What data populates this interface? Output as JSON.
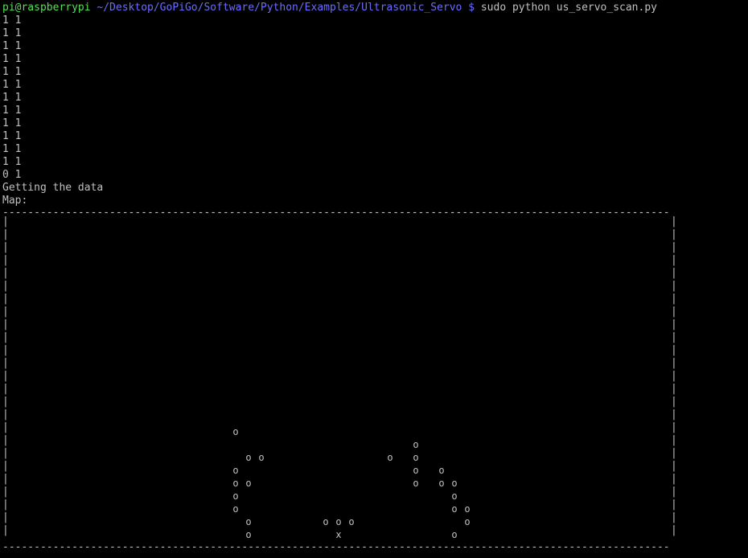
{
  "prompt": {
    "user_host": "pi@raspberrypi",
    "path": "~/Desktop/GoPiGo/Software/Python/Examples/Ultrasonic_Servo",
    "symbol": "$",
    "command": "sudo python us_servo_scan.py"
  },
  "output_lines": [
    "1 1",
    "1 1",
    "1 1",
    "1 1",
    "1 1",
    "1 1",
    "1 1",
    "1 1",
    "1 1",
    "1 1",
    "1 1",
    "1 1",
    "0 1",
    "Getting the data",
    "Map:"
  ],
  "map": {
    "border_char": "-",
    "side_char": "|",
    "obstacle_char": "o",
    "robot_char": "x"
  },
  "colors": {
    "background": "#000000",
    "text": "#c0c0c0",
    "prompt_user": "#55e055",
    "prompt_path": "#6c6cff"
  }
}
